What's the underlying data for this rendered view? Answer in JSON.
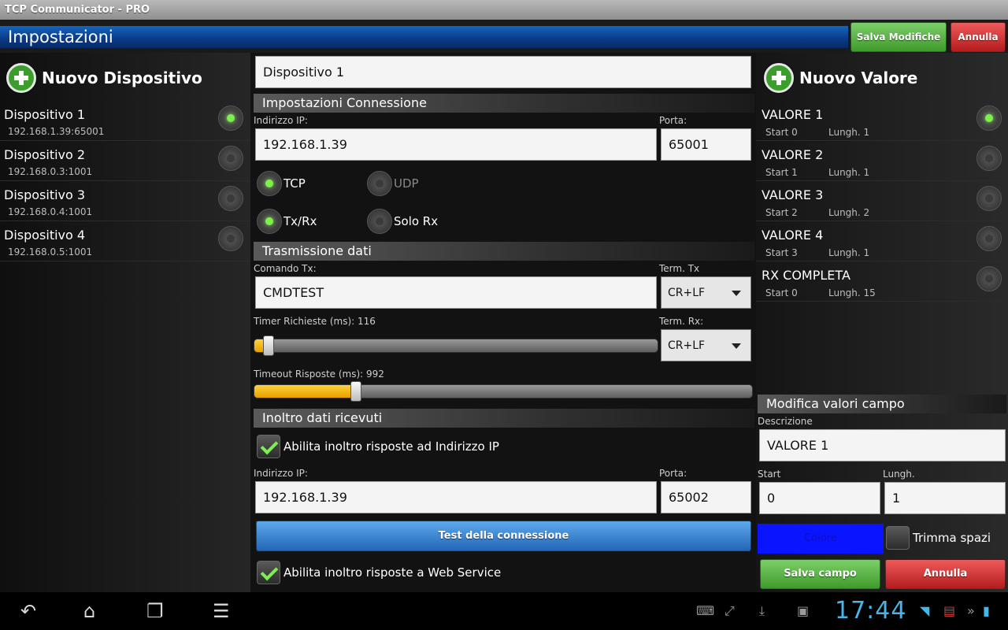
{
  "window": {
    "title": "TCP Communicator - PRO"
  },
  "header": {
    "title": "Impostazioni",
    "save_label": "Salva Modifiche",
    "cancel_label": "Annulla"
  },
  "devices": {
    "add_label": "Nuovo Dispositivo",
    "items": [
      {
        "name": "Dispositivo 1",
        "address": "192.168.1.39:65001",
        "selected": true
      },
      {
        "name": "Dispositivo 2",
        "address": "192.168.0.3:1001",
        "selected": false
      },
      {
        "name": "Dispositivo 3",
        "address": "192.168.0.4:1001",
        "selected": false
      },
      {
        "name": "Dispositivo 4",
        "address": "192.168.0.5:1001",
        "selected": false
      }
    ]
  },
  "settings": {
    "device_name": "Dispositivo 1",
    "connection": {
      "section_title": "Impostazioni Connessione",
      "ip_label": "Indirizzo IP:",
      "ip_value": "192.168.1.39",
      "port_label": "Porta:",
      "port_value": "65001",
      "protocol_tcp": "TCP",
      "protocol_udp": "UDP",
      "mode_txrx": "Tx/Rx",
      "mode_rx": "Solo Rx"
    },
    "transmission": {
      "section_title": "Trasmissione dati",
      "command_label": "Comando Tx:",
      "command_value": "CMDTEST",
      "term_tx_label": "Term. Tx",
      "term_tx_value": "CR+LF",
      "term_rx_label": "Term. Rx:",
      "term_rx_value": "CR+LF",
      "timer_label": "Timer Richieste (ms): 116",
      "timer_value": 116,
      "timeout_label": "Timeout Risposte (ms): 992",
      "timeout_value": 992
    },
    "forward": {
      "section_title": "Inoltro dati ricevuti",
      "enable_ip_label": "Abilita inoltro risposte ad Indirizzo IP",
      "ip_label": "Indirizzo IP:",
      "ip_value": "192.168.1.39",
      "port_label": "Porta:",
      "port_value": "65002",
      "test_label": "Test della connessione",
      "enable_ws_label": "Abilita inoltro risposte a Web Service"
    }
  },
  "values": {
    "add_label": "Nuovo Valore",
    "items": [
      {
        "name": "VALORE 1",
        "start": "Start 0",
        "length": "Lungh. 1",
        "selected": true
      },
      {
        "name": "VALORE 2",
        "start": "Start 1",
        "length": "Lungh. 1",
        "selected": false
      },
      {
        "name": "VALORE 3",
        "start": "Start 2",
        "length": "Lungh. 2",
        "selected": false
      },
      {
        "name": "VALORE 4",
        "start": "Start 3",
        "length": "Lungh. 1",
        "selected": false
      },
      {
        "name": "RX COMPLETA",
        "start": "Start 0",
        "length": "Lungh. 15",
        "selected": false
      }
    ]
  },
  "field_edit": {
    "section_title": "Modifica valori campo",
    "description_label": "Descrizione",
    "description_value": "VALORE 1",
    "start_label": "Start",
    "start_value": "0",
    "length_label": "Lungh.",
    "length_value": "1",
    "color_label": "Colore",
    "trim_label": "Trimma spazi",
    "save_label": "Salva campo",
    "cancel_label": "Annulla",
    "color": "#0a14ff"
  },
  "status_bar": {
    "clock": "17:44"
  },
  "colors": {
    "accent_green": "#7ef04e",
    "header_blue": "#0b3d8a",
    "clock_blue": "#45b6e8"
  }
}
